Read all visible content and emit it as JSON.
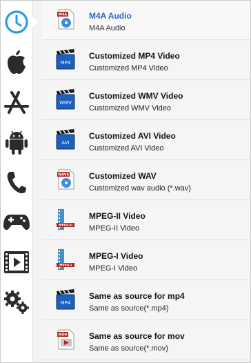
{
  "sidebar": {
    "items": [
      {
        "name": "recent",
        "icon": "clock-icon",
        "active": true
      },
      {
        "name": "apple",
        "icon": "apple-icon"
      },
      {
        "name": "app-store",
        "icon": "app-store-icon"
      },
      {
        "name": "android",
        "icon": "android-icon"
      },
      {
        "name": "phone",
        "icon": "phone-icon"
      },
      {
        "name": "game",
        "icon": "gamepad-icon"
      },
      {
        "name": "video",
        "icon": "film-play-icon"
      },
      {
        "name": "settings",
        "icon": "gears-icon"
      }
    ]
  },
  "formats": [
    {
      "title": "M4A Audio",
      "subtitle": "M4A Audio",
      "icon": "m4a-icon",
      "badge": "M4A",
      "selected": true
    },
    {
      "title": "Customized MP4 Video",
      "subtitle": "Customized MP4 Video",
      "icon": "mp4-clapper-icon",
      "badge": "MP4"
    },
    {
      "title": "Customized WMV Video",
      "subtitle": "Customized WMV Video",
      "icon": "wmv-clapper-icon",
      "badge": "WMV"
    },
    {
      "title": "Customized AVI Video",
      "subtitle": "Customized AVI Video",
      "icon": "avi-clapper-icon",
      "badge": "AVI"
    },
    {
      "title": "Customized WAV",
      "subtitle": "Customized wav audio (*.wav)",
      "icon": "wav-icon",
      "badge": "WAVE"
    },
    {
      "title": "MPEG-II Video",
      "subtitle": "MPEG-II Video",
      "icon": "mpeg2-film-icon",
      "badge": "MPEG-II"
    },
    {
      "title": "MPEG-I Video",
      "subtitle": "MPEG-I Video",
      "icon": "mpeg1-film-icon",
      "badge": "MPEG-I"
    },
    {
      "title": "Same as source for mp4",
      "subtitle": "Same as source(*.mp4)",
      "icon": "mp4-source-icon",
      "badge": "MP4"
    },
    {
      "title": "Same as source for mov",
      "subtitle": "Same as source(*.mov)",
      "icon": "mov-source-icon",
      "badge": "MOV"
    }
  ],
  "colors": {
    "accent": "#2a64c5",
    "clock": "#2a9be3",
    "sidebar_icon": "#2b2b2b"
  }
}
